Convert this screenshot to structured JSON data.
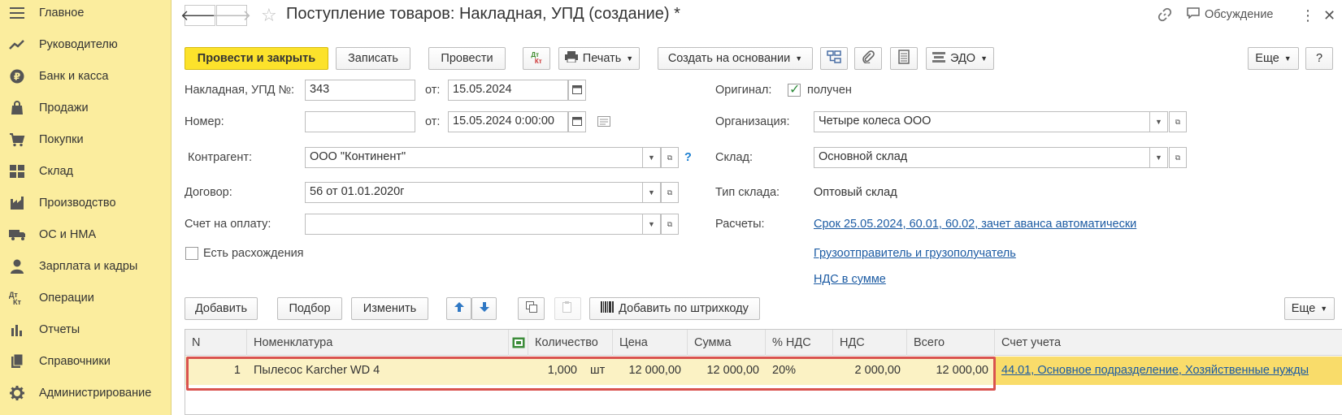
{
  "sidebar": {
    "items": [
      {
        "label": "Главное",
        "icon": "menu-icon"
      },
      {
        "label": "Руководителю",
        "icon": "trend-icon"
      },
      {
        "label": "Банк и касса",
        "icon": "ruble-icon"
      },
      {
        "label": "Продажи",
        "icon": "bag-icon"
      },
      {
        "label": "Покупки",
        "icon": "cart-icon"
      },
      {
        "label": "Склад",
        "icon": "warehouse-icon"
      },
      {
        "label": "Производство",
        "icon": "factory-icon"
      },
      {
        "label": "ОС и НМА",
        "icon": "truck-icon"
      },
      {
        "label": "Зарплата и кадры",
        "icon": "person-icon"
      },
      {
        "label": "Операции",
        "icon": "dt-kt-icon"
      },
      {
        "label": "Отчеты",
        "icon": "chart-icon"
      },
      {
        "label": "Справочники",
        "icon": "books-icon"
      },
      {
        "label": "Администрирование",
        "icon": "gear-icon"
      }
    ]
  },
  "header": {
    "title": "Поступление товаров: Накладная, УПД (создание) *",
    "discussion": "Обсуждение"
  },
  "toolbar": {
    "post_close": "Провести и закрыть",
    "save": "Записать",
    "post": "Провести",
    "dtkt": "Дт Кт",
    "print": "Печать",
    "create_based": "Создать на основании",
    "edo": "ЭДО",
    "more": "Еще",
    "help": "?"
  },
  "form": {
    "invoice_label": "Накладная, УПД №:",
    "invoice_value": "343",
    "from_label": "от:",
    "invoice_date": "15.05.2024",
    "number_label": "Номер:",
    "number_value": "",
    "number_date": "15.05.2024  0:00:00",
    "contractor_label": "Контрагент:",
    "contractor_value": "ООО \"Континент\"",
    "contract_label": "Договор:",
    "contract_value": "56 от 01.01.2020г",
    "payment_label": "Счет на оплату:",
    "payment_value": "",
    "discrepancy_label": "Есть расхождения",
    "original_label": "Оригинал:",
    "original_value": "получен",
    "org_label": "Организация:",
    "org_value": "Четыре колеса ООО",
    "warehouse_label": "Склад:",
    "warehouse_value": "Основной склад",
    "warehouse_type_label": "Тип склада:",
    "warehouse_type_value": "Оптовый склад",
    "settlements_label": "Расчеты:",
    "settlements_link": "Срок 25.05.2024, 60.01, 60.02, зачет аванса автоматически",
    "shipper_link": "Грузоотправитель и грузополучатель",
    "vat_link": "НДС в сумме",
    "help_q": "?"
  },
  "table_toolbar": {
    "add": "Добавить",
    "pick": "Подбор",
    "edit": "Изменить",
    "barcode": "Добавить по штрихкоду",
    "more": "Еще"
  },
  "table": {
    "headers": [
      "N",
      "Номенклатура",
      "Количество",
      "Цена",
      "Сумма",
      "% НДС",
      "НДС",
      "Всего",
      "Счет учета"
    ],
    "rows": [
      {
        "n": "1",
        "item": "Пылесос Karcher WD 4",
        "qty": "1,000",
        "unit": "шт",
        "price": "12 000,00",
        "sum": "12 000,00",
        "vat_rate": "20%",
        "vat": "2 000,00",
        "total": "12 000,00",
        "account": "44.01, Основное подразделение, Хозяйственные нужды"
      }
    ]
  }
}
